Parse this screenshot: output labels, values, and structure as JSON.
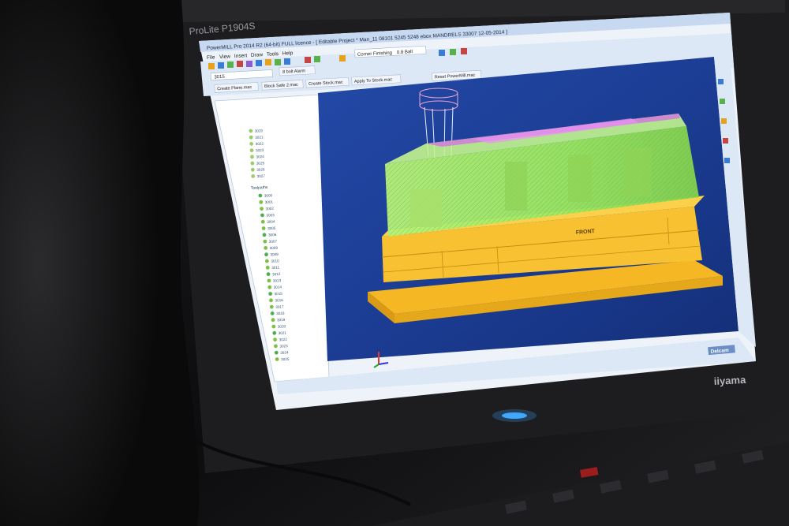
{
  "monitor": {
    "model_label": "ProLite P1904S",
    "brand_label": "iiyama"
  },
  "app": {
    "title_bar": "PowerMILL Pro 2014 R2 (64-bit) FULL licence - [ Editable Project * Man_11 08101 5245 5248 ebox MANDRELS 33007 12-05-2014 ]",
    "menu": [
      "File",
      "View",
      "Insert",
      "Draw",
      "Tools",
      "Help"
    ],
    "strategy_label": "Corner Finishing",
    "strategy_value": "0.8 Ball",
    "buttons": {
      "create_plane": "Create Plane.mac",
      "block_safe": "Block Safe 2.mac",
      "create_stock": "Create Stock.mac",
      "apply_to_stock": "Apply To Stock.mac",
      "reset_powermill": "Reset PowerMill.mac",
      "alarm": "8 bolt Alarm"
    },
    "tool_value": "3015"
  },
  "explorer": {
    "toolpaths_label": "Toolpaths",
    "items_top": [
      "3020",
      "3021",
      "3022",
      "3023",
      "3024",
      "3025",
      "3026",
      "3027"
    ],
    "items_toolpaths": [
      "3000",
      "3001",
      "3002",
      "3003",
      "3004",
      "3005",
      "3006",
      "3007",
      "3008",
      "3009",
      "3010",
      "3011",
      "3012",
      "3013",
      "3014",
      "3015",
      "3016",
      "3017",
      "3018",
      "3019",
      "3020",
      "3021",
      "3022",
      "3023",
      "3024",
      "3025"
    ]
  },
  "viewport": {
    "front_label": "FRONT",
    "brand": "Delcam"
  },
  "colors": {
    "viewport_bg": "#1b3a93",
    "block": "#f6c02b",
    "toolpath_green": "#9bef5f",
    "toolpath_magenta": "#d46ee6",
    "ui_bg": "#eaf1fb"
  }
}
